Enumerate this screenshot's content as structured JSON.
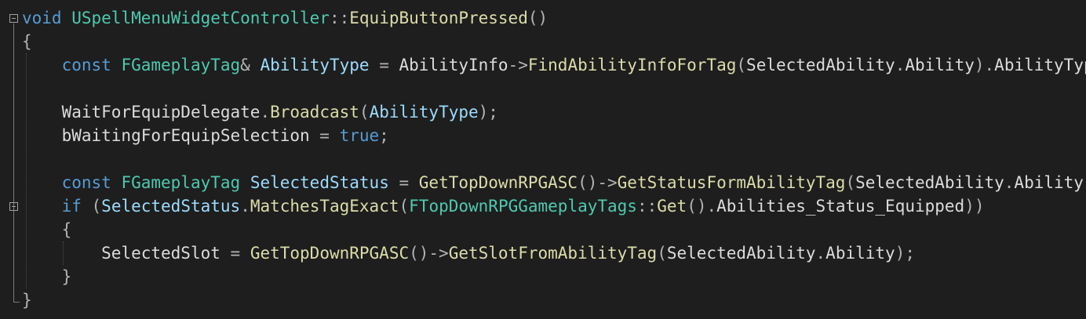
{
  "code_lines": [
    {
      "tokens": [
        {
          "t": "void",
          "c": "kw"
        },
        {
          "t": " "
        },
        {
          "t": "USpellMenuWidgetController",
          "c": "ty"
        },
        {
          "t": "::",
          "c": "pu"
        },
        {
          "t": "EquipButtonPressed",
          "c": "fn"
        },
        {
          "t": "()",
          "c": "pu"
        }
      ]
    },
    {
      "tokens": [
        {
          "t": "{",
          "c": "pu"
        }
      ]
    },
    {
      "tokens": [
        {
          "t": "    "
        },
        {
          "t": "const",
          "c": "kw"
        },
        {
          "t": " "
        },
        {
          "t": "FGameplayTag",
          "c": "ty"
        },
        {
          "t": "&",
          "c": "pu"
        },
        {
          "t": " "
        },
        {
          "t": "AbilityType",
          "c": "var"
        },
        {
          "t": " = ",
          "c": "pu"
        },
        {
          "t": "AbilityInfo",
          "c": "tx"
        },
        {
          "t": "->",
          "c": "pu"
        },
        {
          "t": "FindAbilityInfoForTag",
          "c": "fn"
        },
        {
          "t": "(",
          "c": "pu"
        },
        {
          "t": "SelectedAbility",
          "c": "tx"
        },
        {
          "t": ".",
          "c": "pu"
        },
        {
          "t": "Ability",
          "c": "tx"
        },
        {
          "t": ").",
          "c": "pu"
        },
        {
          "t": "AbilityType",
          "c": "tx"
        },
        {
          "t": ";",
          "c": "pu"
        }
      ]
    },
    {
      "tokens": []
    },
    {
      "tokens": [
        {
          "t": "    "
        },
        {
          "t": "WaitForEquipDelegate",
          "c": "tx"
        },
        {
          "t": ".",
          "c": "pu"
        },
        {
          "t": "Broadcast",
          "c": "fn"
        },
        {
          "t": "(",
          "c": "pu"
        },
        {
          "t": "AbilityType",
          "c": "var"
        },
        {
          "t": ");",
          "c": "pu"
        }
      ]
    },
    {
      "tokens": [
        {
          "t": "    "
        },
        {
          "t": "bWaitingForEquipSelection",
          "c": "tx"
        },
        {
          "t": " = ",
          "c": "pu"
        },
        {
          "t": "true",
          "c": "kw"
        },
        {
          "t": ";",
          "c": "pu"
        }
      ]
    },
    {
      "tokens": []
    },
    {
      "tokens": [
        {
          "t": "    "
        },
        {
          "t": "const",
          "c": "kw"
        },
        {
          "t": " "
        },
        {
          "t": "FGameplayTag",
          "c": "ty"
        },
        {
          "t": " "
        },
        {
          "t": "SelectedStatus",
          "c": "var"
        },
        {
          "t": " = ",
          "c": "pu"
        },
        {
          "t": "GetTopDownRPGASC",
          "c": "fn"
        },
        {
          "t": "()->",
          "c": "pu"
        },
        {
          "t": "GetStatusFormAbilityTag",
          "c": "fn"
        },
        {
          "t": "(",
          "c": "pu"
        },
        {
          "t": "SelectedAbility",
          "c": "tx"
        },
        {
          "t": ".",
          "c": "pu"
        },
        {
          "t": "Ability",
          "c": "tx"
        },
        {
          "t": ");",
          "c": "pu"
        }
      ]
    },
    {
      "tokens": [
        {
          "t": "    "
        },
        {
          "t": "if",
          "c": "kw"
        },
        {
          "t": " (",
          "c": "pu"
        },
        {
          "t": "SelectedStatus",
          "c": "var"
        },
        {
          "t": ".",
          "c": "pu"
        },
        {
          "t": "MatchesTagExact",
          "c": "fn"
        },
        {
          "t": "(",
          "c": "pu"
        },
        {
          "t": "FTopDownRPGGameplayTags",
          "c": "ty"
        },
        {
          "t": "::",
          "c": "pu"
        },
        {
          "t": "Get",
          "c": "fn"
        },
        {
          "t": "().",
          "c": "pu"
        },
        {
          "t": "Abilities_Status_Equipped",
          "c": "tx"
        },
        {
          "t": "))",
          "c": "pu"
        }
      ]
    },
    {
      "tokens": [
        {
          "t": "    "
        },
        {
          "t": "{",
          "c": "pu"
        }
      ]
    },
    {
      "tokens": [
        {
          "t": "        "
        },
        {
          "t": "SelectedSlot",
          "c": "tx"
        },
        {
          "t": " = ",
          "c": "pu"
        },
        {
          "t": "GetTopDownRPGASC",
          "c": "fn"
        },
        {
          "t": "()->",
          "c": "pu"
        },
        {
          "t": "GetSlotFromAbilityTag",
          "c": "fn"
        },
        {
          "t": "(",
          "c": "pu"
        },
        {
          "t": "SelectedAbility",
          "c": "tx"
        },
        {
          "t": ".",
          "c": "pu"
        },
        {
          "t": "Ability",
          "c": "tx"
        },
        {
          "t": ");",
          "c": "pu"
        }
      ]
    },
    {
      "tokens": [
        {
          "t": "    "
        },
        {
          "t": "}",
          "c": "pu"
        }
      ]
    },
    {
      "tokens": [
        {
          "t": "}",
          "c": "pu"
        }
      ]
    }
  ],
  "colors": {
    "background": "#1e1e1e",
    "keyword": "#569cd6",
    "type": "#4ec9b0",
    "function": "#dcdcaa",
    "variable": "#9cdcfe",
    "text": "#dcdcdc"
  },
  "icons": {
    "fold_toggle": "collapse-minus-icon"
  }
}
